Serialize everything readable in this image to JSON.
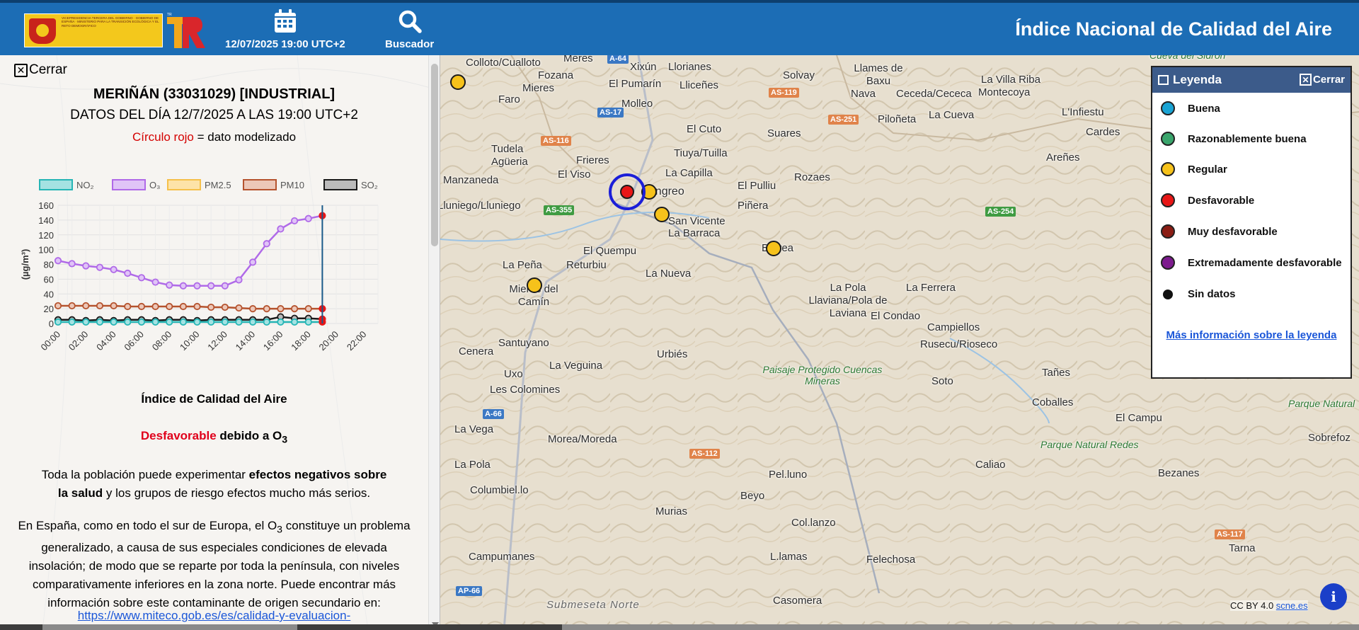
{
  "header": {
    "logo_text": "VICEPRESIDENCIA TERCERA DEL GOBIERNO · GOBIERNO DE ESPAÑA · MINISTERIO PARA LA TRANSICIÓN ECOLÓGICA Y EL RETO DEMOGRÁFICO",
    "logo_mark": "TR",
    "date_label": "12/07/2025 19:00 UTC+2",
    "search_label": "Buscador",
    "title": "Índice Nacional de Calidad del Aire",
    "color": "#1c6db5"
  },
  "panel": {
    "close_label": "Cerrar",
    "station": "MERIÑÁN (33031029) [INDUSTRIAL]",
    "data_day": "DATOS DEL DÍA 12/7/2025 A LAS 19:00 UTC+2",
    "model_red": "Círculo rojo",
    "model_rest": " = dato modelizado",
    "aqi_title": "Índice de Calidad del Aire",
    "aqi_status": "Desfavorable",
    "aqi_due": " debido a O",
    "aqi_sub": "3",
    "effects_1": "Toda la población puede experimentar ",
    "effects_bold": "efectos negativos sobre la salud",
    "effects_2": " y los grupos de riesgo efectos mucho más serios.",
    "info_1": "En España, como en todo el sur de Europa, el O",
    "info_sub": "3",
    "info_2": " constituye un problema generalizado, a causa de sus especiales condiciones de elevada insolación; de modo que se reparte por toda la península, con niveles comparativamente inferiores en la zona norte. Puede encontrar más información sobre este contaminante de origen secundario en:",
    "info_link": "https://www.miteco.gob.es/es/calidad-y-evaluacion-"
  },
  "chart_data": {
    "type": "line",
    "ylabel": "(µg/m³)",
    "ylim": [
      0,
      160
    ],
    "yticks": [
      0,
      20,
      40,
      60,
      80,
      100,
      120,
      140,
      160
    ],
    "xticks": [
      "00:00",
      "02:00",
      "04:00",
      "06:00",
      "08:00",
      "10:00",
      "12:00",
      "14:00",
      "16:00",
      "18:00",
      "20:00",
      "22:00"
    ],
    "x": [
      0,
      1,
      2,
      3,
      4,
      5,
      6,
      7,
      8,
      9,
      10,
      11,
      12,
      13,
      14,
      15,
      16,
      17,
      18,
      19
    ],
    "current_hour": 19,
    "series": [
      {
        "name": "NO₂",
        "fill": "#a4e2e2",
        "color": "#26b5b5",
        "values": [
          2,
          2,
          2,
          2,
          2,
          2,
          2,
          2,
          2,
          2,
          2,
          2,
          2,
          2,
          2,
          2,
          2,
          2,
          2,
          2
        ]
      },
      {
        "name": "O₃",
        "fill": "#e0c4f7",
        "color": "#b06ae8",
        "values": [
          85,
          81,
          78,
          76,
          73,
          68,
          62,
          56,
          52,
          51,
          51,
          51,
          51,
          59,
          83,
          108,
          128,
          139,
          142,
          146
        ]
      },
      {
        "name": "PM2.5",
        "fill": "#fde3a8",
        "color": "#f5c04a",
        "values": [
          null,
          null,
          null,
          null,
          null,
          null,
          null,
          null,
          null,
          null,
          null,
          null,
          null,
          null,
          null,
          null,
          null,
          null,
          null,
          null
        ]
      },
      {
        "name": "PM10",
        "fill": "#ecc7b8",
        "color": "#b5532e",
        "values": [
          24,
          24,
          24,
          24,
          24,
          23,
          23,
          23,
          23,
          23,
          23,
          22,
          22,
          21,
          20,
          20,
          20,
          20,
          20,
          20
        ]
      },
      {
        "name": "SO₂",
        "fill": "#bbbbbb",
        "color": "#1a1a1a",
        "values": [
          5,
          5,
          4,
          5,
          4,
          5,
          5,
          4,
          5,
          5,
          4,
          5,
          5,
          5,
          5,
          5,
          9,
          7,
          7,
          6
        ]
      }
    ],
    "last_point_colors": {
      "O₃": "#e81616",
      "PM10": "#e81616",
      "NO₂": "#e81616",
      "SO₂": "#e81616"
    }
  },
  "legend": {
    "title": "Leyenda",
    "close_label": "Cerrar",
    "items": [
      {
        "label": "Buena",
        "color": "#1aa4d4"
      },
      {
        "label": "Razonablemente buena",
        "color": "#3aa56c"
      },
      {
        "label": "Regular",
        "color": "#f6c21b"
      },
      {
        "label": "Desfavorable",
        "color": "#e81616"
      },
      {
        "label": "Muy desfavorable",
        "color": "#8b1d14"
      },
      {
        "label": "Extremadamente desfavorable",
        "color": "#7d1b8e"
      },
      {
        "label": "Sin datos",
        "color": "#111111"
      }
    ],
    "more_link": "Más información sobre la leyenda"
  },
  "map": {
    "places": [
      "Colloto/Cualloto",
      "Meres",
      "Xixún",
      "Llorianes",
      "Solvay",
      "Llames de Baxu",
      "La Villa Riba",
      "Fozana",
      "El Pumarín",
      "Lliceñes",
      "Nava",
      "Ceceda/Cececa",
      "Montecoya",
      "Mieres",
      "Faro",
      "Molleo",
      "La Cueva",
      "L'Infiestu",
      "El Cuto",
      "Suares",
      "Piloñeta",
      "Cardes",
      "Tudela Agüeria",
      "Frieres",
      "Tiuya/Tuilla",
      "Areñes",
      "El Viso",
      "La Capilla",
      "Manzaneda",
      "Langreo",
      "El Pulliu",
      "Rozaes",
      "Lluniego/Lluniego",
      "Piñera",
      "San Vicente La Barraca",
      "El Quempu",
      "Barrea",
      "La Peña",
      "Returbiu",
      "La Nueva",
      "Mieres del Camín",
      "La Pola Llaviana/Pola de Laviana",
      "La Ferrera",
      "El Condao",
      "Santuyano",
      "Campiellos",
      "Rusecu/Rioseco",
      "Cenera",
      "Urbiés",
      "La Veguina",
      "Uxo",
      "Soto",
      "Tañes",
      "Les Colomines",
      "Coballes",
      "La Vega",
      "El Campu",
      "Morea/Moreda",
      "Sobrefoz",
      "La Pola",
      "Caliao",
      "Bezanes",
      "Columbiel.lo",
      "Pel.luno",
      "Beyo",
      "Murias",
      "Col.lanzo",
      "Tarna",
      "Campumanes",
      "L.lamas",
      "Felechosa",
      "Casomera",
      "Submeseta Norte",
      "Paisaje Protegido Cuencas Mineras",
      "Parque Natural Redes",
      "Parque Natural",
      "Cueva del Sidrón"
    ],
    "roads": [
      "A-64",
      "AS-119",
      "AS-17",
      "AS-251",
      "AS-116",
      "AS-355",
      "AS-254",
      "A-66",
      "AS-112",
      "AS-117",
      "AP-66"
    ],
    "attribution_prefix": "CC BY 4.0 ",
    "attribution_link": "scne.es"
  }
}
